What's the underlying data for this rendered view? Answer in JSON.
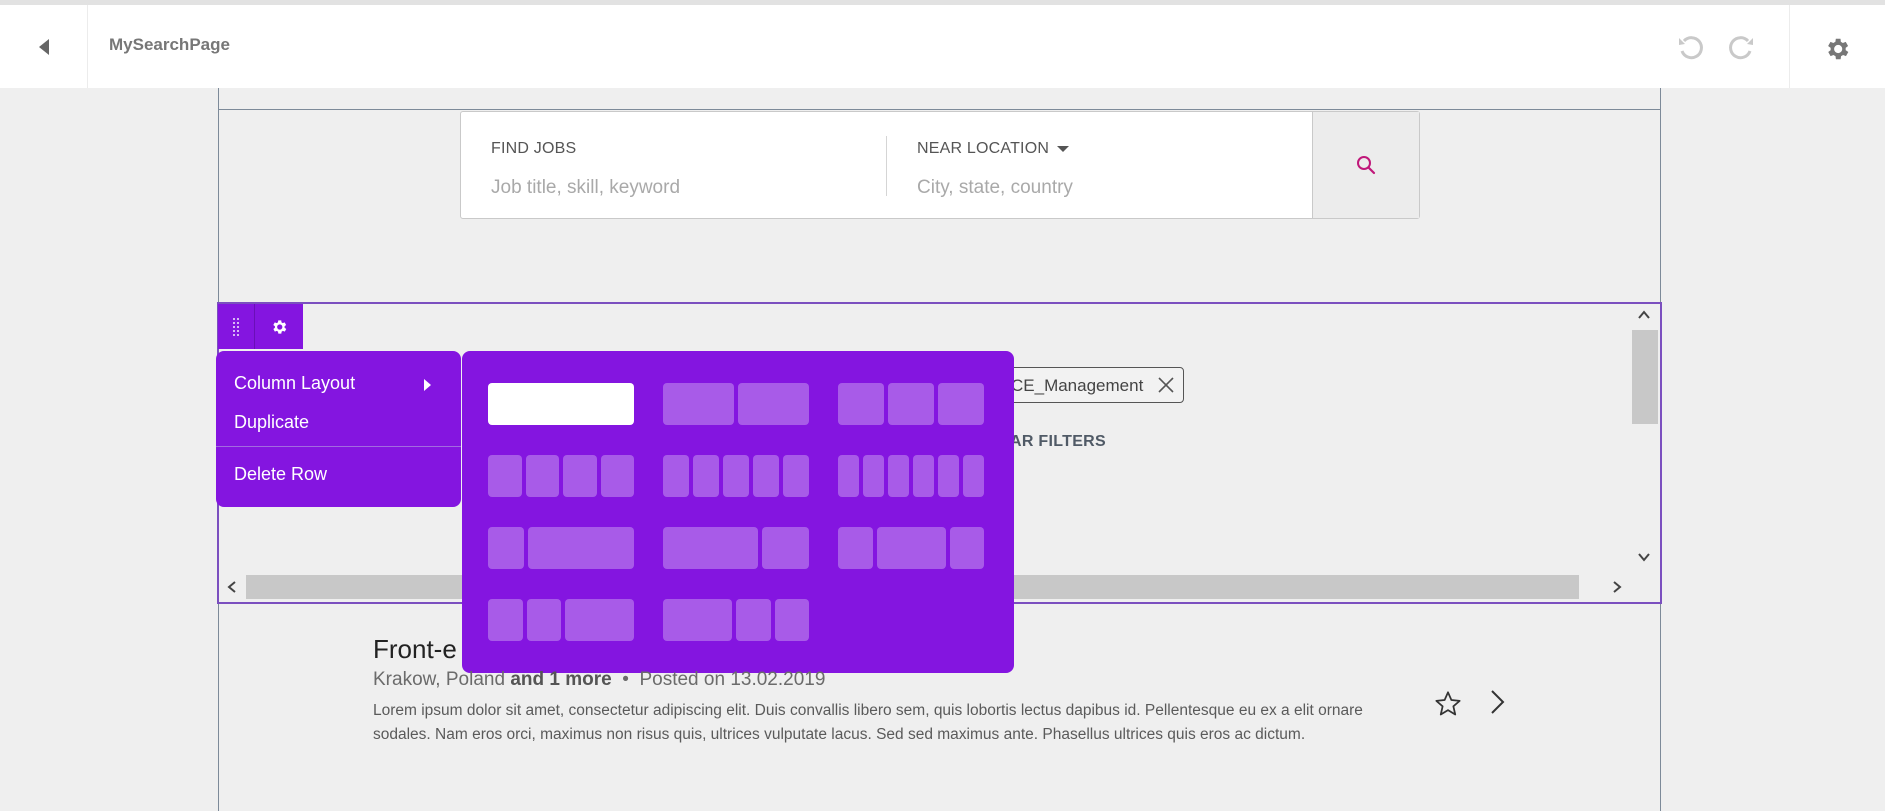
{
  "topbar": {
    "page_name": "MySearchPage"
  },
  "search": {
    "find_jobs_label": "FIND JOBS",
    "find_jobs_placeholder": "Job title, skill, keyword",
    "location_label": "NEAR LOCATION",
    "location_placeholder": "City, state, country"
  },
  "filters": {
    "tag": "CE_Management",
    "clear_label": "EAR FILTERS"
  },
  "context_menu": {
    "column_layout": "Column Layout",
    "duplicate": "Duplicate",
    "delete_row": "Delete Row"
  },
  "layouts": [
    {
      "cols": [
        12
      ],
      "active": true
    },
    {
      "cols": [
        6,
        6
      ]
    },
    {
      "cols": [
        4,
        4,
        4
      ]
    },
    {
      "cols": [
        3,
        3,
        3,
        3
      ]
    },
    {
      "cols": [
        2,
        2,
        2,
        2,
        2
      ]
    },
    {
      "cols": [
        2,
        2,
        2,
        2,
        2,
        2
      ]
    },
    {
      "cols": [
        3,
        9
      ]
    },
    {
      "cols": [
        8,
        4
      ]
    },
    {
      "cols": [
        3,
        6,
        3
      ]
    },
    {
      "cols": [
        3,
        3,
        6
      ]
    },
    {
      "cols": [
        6,
        3,
        3
      ]
    }
  ],
  "job": {
    "title": "Front-e",
    "location": "Krakow, Poland",
    "more": "and 1 more",
    "separator": "•",
    "posted": "Posted on 13.02.2019",
    "description": "Lorem ipsum dolor sit amet, consectetur adipiscing elit. Duis convallis libero sem, quis lobortis lectus dapibus id. Pellentesque eu ex a elit ornare sodales. Nam eros orci, maximus non risus quis, ultrices vulputate lacus. Sed sed maximus ante. Phasellus ultrices quis eros ac dictum."
  },
  "colors": {
    "accent": "#8415e0",
    "accent_light": "#a85be8",
    "search_icon": "#c0187a"
  }
}
